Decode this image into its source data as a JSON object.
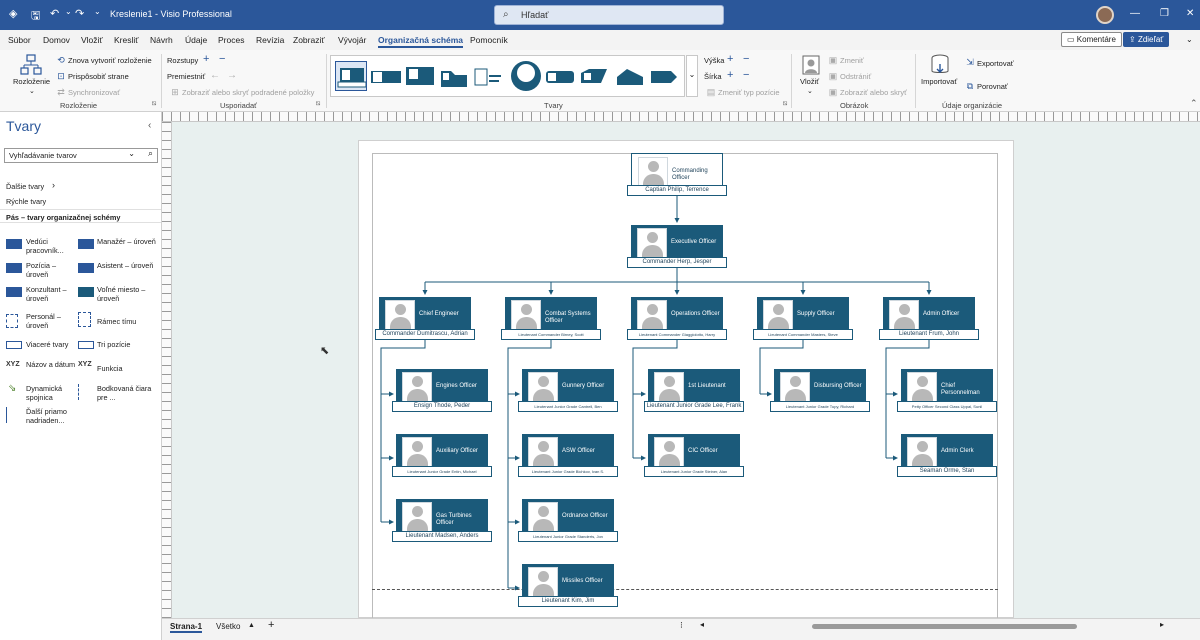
{
  "titlebar": {
    "doc_title": "Kreslenie1 - Visio Professional",
    "search_placeholder": "Hľadať",
    "search_icon": "search-icon",
    "qa_icons": [
      "visio-logo-icon",
      "save-icon",
      "undo-icon",
      "redo-icon",
      "customize-icon"
    ]
  },
  "menu": {
    "tabs": [
      "Súbor",
      "Domov",
      "Vložiť",
      "Kresliť",
      "Návrh",
      "Údaje",
      "Proces",
      "Revízia",
      "Zobraziť",
      "Vývojár",
      "Organizačná schéma",
      "Pomocník"
    ],
    "active_tab": "Organizačná schéma",
    "comments": "Komentáre",
    "share": "Zdieľať"
  },
  "ribbon": {
    "layout_button": "Rozloženie",
    "relayout": "Znova vytvoriť rozloženie",
    "fit_page": "Prispôsobiť strane",
    "synchronize": "Synchronizovať",
    "group_layout": "Rozloženie",
    "spacing": "Rozstupy",
    "move": "Premiestniť",
    "show_hide_subordinates": "Zobraziť alebo skryť podradené položky",
    "group_arrange": "Usporiadať",
    "height": "Výška",
    "width": "Šírka",
    "change_position_type": "Zmeniť typ pozície",
    "group_shapes": "Tvary",
    "insert": "Vložiť",
    "change": "Zmeniť",
    "delete": "Odstrániť",
    "show_hide": "Zobraziť alebo skryť",
    "group_picture": "Obrázok",
    "import": "Importovať",
    "export": "Exportovať",
    "compare": "Porovnať",
    "group_org_data": "Údaje organizácie"
  },
  "shapes_pane": {
    "title": "Tvary",
    "search_placeholder": "Vyhľadávanie tvarov",
    "more_shapes": "Ďalšie tvary",
    "quick_shapes": "Rýchle tvary",
    "stencil": "Pás – tvary organizačnej schémy",
    "items": [
      "Vedúci pracovník...",
      "Manažér – úroveň",
      "Pozícia – úroveň",
      "Asistent – úroveň",
      "Konzultant – úroveň",
      "Voľné miesto – úroveň",
      "Personál – úroveň",
      "Rámec tímu",
      "Viaceré tvary",
      "Tri pozície",
      "Názov a dátum",
      "Funkcia",
      "Dynamická spojnica",
      "Bodkovaná čiara pre ...",
      "Ďalší priamo nadriaden..."
    ]
  },
  "org_chart": {
    "nodes": [
      {
        "title": "Commanding Officer",
        "name": "Captian Philip, Terrence"
      },
      {
        "title": "Executive Officer",
        "name": "Commander Herp, Jesper"
      },
      {
        "title": "Chief Engineer",
        "name": "Commander Dumitrascu, Adrian"
      },
      {
        "title": "Combat Systems Officer",
        "name": "Lieutenant Commander Birney, Scott"
      },
      {
        "title": "Operations Officer",
        "name": "Lieutenant Commander Giaggiolotto, Harry"
      },
      {
        "title": "Supply Officer",
        "name": "Lieutenant Commander Masters, Steve"
      },
      {
        "title": "Admin Officer",
        "name": "Lieutenant Frum, John"
      },
      {
        "title": "Engines Officer",
        "name": "Ensign Thode, Peder"
      },
      {
        "title": "Auxiliary Officer",
        "name": "Lieutenant Junior Grade Entin, Michael"
      },
      {
        "title": "Gas Turbines Officer",
        "name": "Lieutenant Madsen, Anders"
      },
      {
        "title": "Gunnery Officer",
        "name": "Lieutenant Junior Grade Cantrell, Ben"
      },
      {
        "title": "ASW Officer",
        "name": "Lieutenant Junior Grade Bichkov, Ivan S."
      },
      {
        "title": "Ordnance Officer",
        "name": "Lieutenant Junior Grade Standerts, Jon"
      },
      {
        "title": "Missiles Officer",
        "name": "Lieutenant Kim, Jim"
      },
      {
        "title": "1st Lieutenant",
        "name": "Lieutenant Junior Grade Lee, Frank"
      },
      {
        "title": "CIC Officer",
        "name": "Lieutenant Junior Grade Steiner, Alan"
      },
      {
        "title": "Disbursing Officer",
        "name": "Lieutenant Junior Grade Tupy, Richard"
      },
      {
        "title": "Chief Personnelman",
        "name": "Petty Officer Second Class Uppal, Sunil"
      },
      {
        "title": "Admin Clerk",
        "name": "Seaman Orme, Stan"
      }
    ]
  },
  "status": {
    "page_tab": "Strana-1",
    "all_pages": "Všetko",
    "add_page": "+"
  }
}
